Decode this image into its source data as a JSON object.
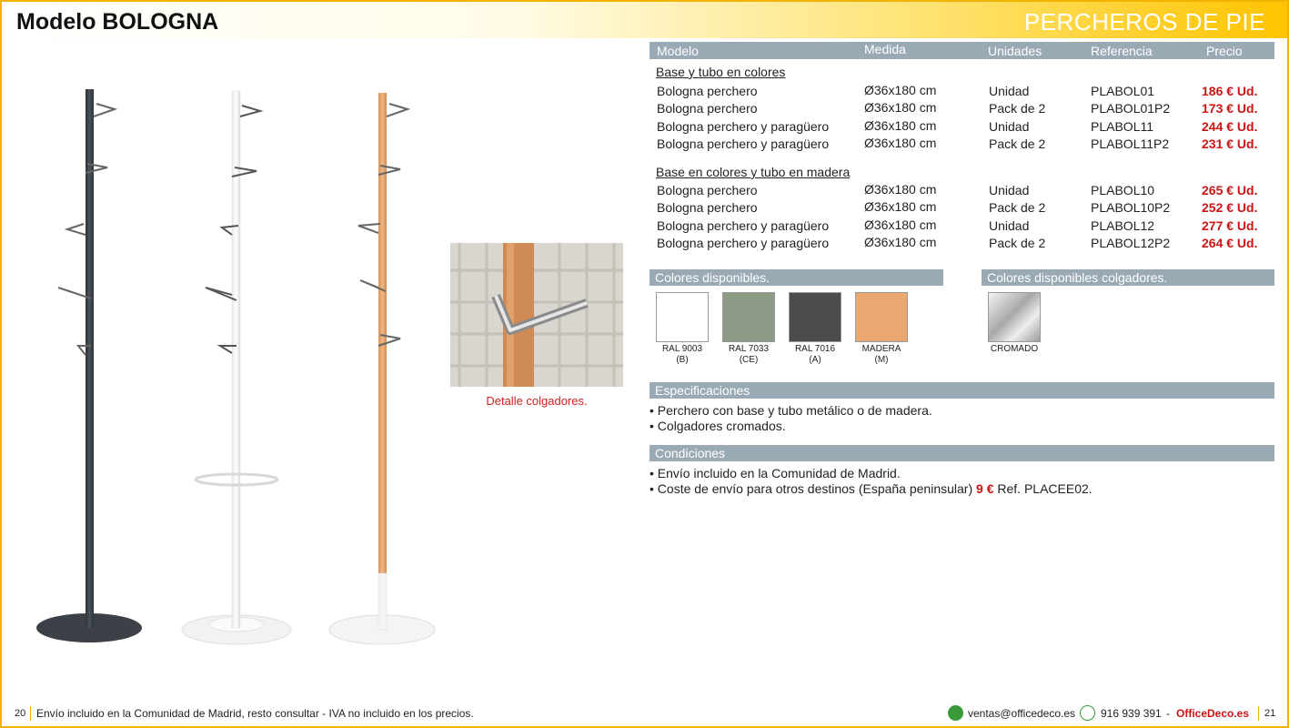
{
  "header": {
    "model": "Modelo BOLOGNA",
    "section": "PERCHEROS DE PIE"
  },
  "detail_caption": "Detalle colgadores.",
  "table": {
    "columns": [
      "Modelo",
      "Medida",
      "Unidades",
      "Referencia",
      "Precio"
    ],
    "groups": [
      {
        "title": "Base y tubo en colores",
        "rows": [
          {
            "modelo": "Bologna perchero",
            "medida": "Ø36x180 cm",
            "unidades": "Unidad",
            "referencia": "PLABOL01",
            "precio": "186 € Ud."
          },
          {
            "modelo": "Bologna perchero",
            "medida": "Ø36x180 cm",
            "unidades": "Pack de 2",
            "referencia": "PLABOL01P2",
            "precio": "173 € Ud."
          },
          {
            "modelo": "Bologna perchero y paragüero",
            "medida": "Ø36x180 cm",
            "unidades": "Unidad",
            "referencia": "PLABOL11",
            "precio": "244 € Ud."
          },
          {
            "modelo": "Bologna perchero y paragüero",
            "medida": "Ø36x180 cm",
            "unidades": "Pack de 2",
            "referencia": "PLABOL11P2",
            "precio": "231 € Ud."
          }
        ]
      },
      {
        "title": "Base en colores y tubo en madera",
        "rows": [
          {
            "modelo": "Bologna perchero",
            "medida": "Ø36x180 cm",
            "unidades": "Unidad",
            "referencia": "PLABOL10",
            "precio": "265 € Ud."
          },
          {
            "modelo": "Bologna perchero",
            "medida": "Ø36x180 cm",
            "unidades": "Pack de 2",
            "referencia": "PLABOL10P2",
            "precio": "252 € Ud."
          },
          {
            "modelo": "Bologna perchero y paragüero",
            "medida": "Ø36x180 cm",
            "unidades": "Unidad",
            "referencia": "PLABOL12",
            "precio": "277 € Ud."
          },
          {
            "modelo": "Bologna perchero y paragüero",
            "medida": "Ø36x180 cm",
            "unidades": "Pack de 2",
            "referencia": "PLABOL12P2",
            "precio": "264 € Ud."
          }
        ]
      }
    ]
  },
  "colors": {
    "title": "Colores disponibles.",
    "items": [
      {
        "name": "RAL 9003",
        "code": "(B)",
        "color": "#ffffff"
      },
      {
        "name": "RAL 7033",
        "code": "(CE)",
        "color": "#8c9a86"
      },
      {
        "name": "RAL 7016",
        "code": "(A)",
        "color": "#4a4c4e"
      },
      {
        "name": "MADERA",
        "code": "(M)",
        "color": "#e8a870"
      }
    ]
  },
  "hanger_colors": {
    "title": "Colores disponibles colgadores.",
    "items": [
      {
        "name": "CROMADO",
        "color": "#c8c8c8"
      }
    ]
  },
  "specs": {
    "title": "Especificaciones",
    "items": [
      "Perchero con base y tubo metálico o de madera.",
      "Colgadores cromados."
    ]
  },
  "conditions": {
    "title": "Condiciones",
    "item1": "Envío incluido en la Comunidad de Madrid.",
    "item2_pre": "Coste de envío para otros destinos (España peninsular)",
    "item2_price": "9 €",
    "item2_post": "Ref. PLACEE02."
  },
  "footer": {
    "page_left": "20",
    "note": "Envío incluido en la Comunidad de Madrid, resto consultar - IVA no incluido en los precios.",
    "email": "ventas@officedeco.es",
    "phone": "916 939 391",
    "dash": "-",
    "brand": "OfficeDeco.es",
    "page_right": "21"
  }
}
